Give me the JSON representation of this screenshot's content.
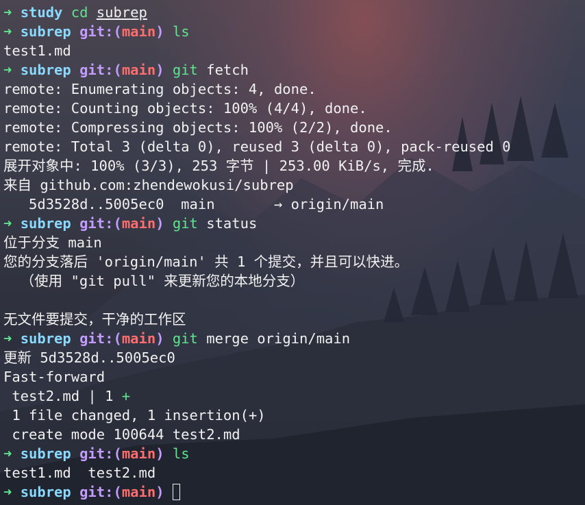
{
  "prompt_arrow": "➜",
  "colors": {
    "arrow": "#5fe58f",
    "directory": "#8ad9ff",
    "git_label": "#c49bff",
    "branch": "#ff6e6e",
    "command": "#5fe58f",
    "text": "#f1f1f1"
  },
  "lines": [
    {
      "type": "prompt",
      "dir": "study",
      "cmd": "cd",
      "args": "subrep"
    },
    {
      "type": "prompt_git",
      "dir": "subrep",
      "git": "git:(",
      "branch": "main",
      "close": ")",
      "cmd": "ls",
      "args": ""
    },
    {
      "type": "output",
      "text": "test1.md"
    },
    {
      "type": "prompt_git",
      "dir": "subrep",
      "git": "git:(",
      "branch": "main",
      "close": ")",
      "cmd": "git",
      "args": "fetch"
    },
    {
      "type": "output",
      "text": "remote: Enumerating objects: 4, done."
    },
    {
      "type": "output",
      "text": "remote: Counting objects: 100% (4/4), done."
    },
    {
      "type": "output",
      "text": "remote: Compressing objects: 100% (2/2), done."
    },
    {
      "type": "output",
      "text": "remote: Total 3 (delta 0), reused 3 (delta 0), pack-reused 0"
    },
    {
      "type": "output",
      "text": "展开对象中: 100% (3/3), 253 字节 | 253.00 KiB/s, 完成."
    },
    {
      "type": "output",
      "text": "来自 github.com:zhendewokusi/subrep"
    },
    {
      "type": "output",
      "text": "   5d3528d..5005ec0  main       → origin/main"
    },
    {
      "type": "prompt_git",
      "dir": "subrep",
      "git": "git:(",
      "branch": "main",
      "close": ")",
      "cmd": "git",
      "args": "status"
    },
    {
      "type": "output",
      "text": "位于分支 main"
    },
    {
      "type": "output",
      "text": "您的分支落后 'origin/main' 共 1 个提交，并且可以快进。"
    },
    {
      "type": "output",
      "text": "  （使用 \"git pull\" 来更新您的本地分支）"
    },
    {
      "type": "output",
      "text": ""
    },
    {
      "type": "output",
      "text": "无文件要提交，干净的工作区"
    },
    {
      "type": "prompt_git",
      "dir": "subrep",
      "git": "git:(",
      "branch": "main",
      "close": ")",
      "cmd": "git",
      "args": "merge origin/main"
    },
    {
      "type": "output",
      "text": "更新 5d3528d..5005ec0"
    },
    {
      "type": "output",
      "text": "Fast-forward"
    },
    {
      "type": "diffstat",
      "text": " test2.md | 1 ",
      "plus": "+"
    },
    {
      "type": "output",
      "text": " 1 file changed, 1 insertion(+)"
    },
    {
      "type": "output",
      "text": " create mode 100644 test2.md"
    },
    {
      "type": "prompt_git",
      "dir": "subrep",
      "git": "git:(",
      "branch": "main",
      "close": ")",
      "cmd": "ls",
      "args": ""
    },
    {
      "type": "output",
      "text": "test1.md  test2.md"
    },
    {
      "type": "prompt_git_cursor",
      "dir": "subrep",
      "git": "git:(",
      "branch": "main",
      "close": ")"
    }
  ]
}
